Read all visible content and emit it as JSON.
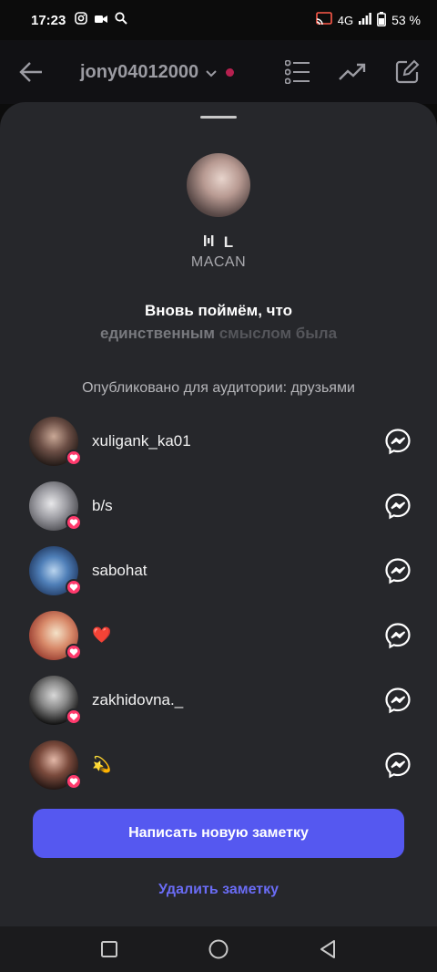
{
  "status": {
    "time": "17:23",
    "network": "4G",
    "battery": "53 %"
  },
  "header": {
    "account": "jony04012000"
  },
  "note": {
    "music_badge": "L",
    "artist": "MACAN",
    "lyric_line1": "Вновь поймём, что",
    "lyric_line2_a": "единственным",
    "lyric_line2_b": " смыслом была",
    "audience": "Опубликовано для аудитории: друзьями"
  },
  "viewers": [
    {
      "name": "xuligank_ka01"
    },
    {
      "name": "b/s"
    },
    {
      "name": "sabohat"
    },
    {
      "name": "❤️"
    },
    {
      "name": "zakhidovna._"
    },
    {
      "name": "💫"
    }
  ],
  "actions": {
    "new_note": "Написать новую заметку",
    "delete_note": "Удалить заметку"
  },
  "colors": {
    "accent": "#5558f0",
    "link": "#6a6cf5",
    "heart": "#ff3a6d",
    "sheet": "#26272b"
  }
}
